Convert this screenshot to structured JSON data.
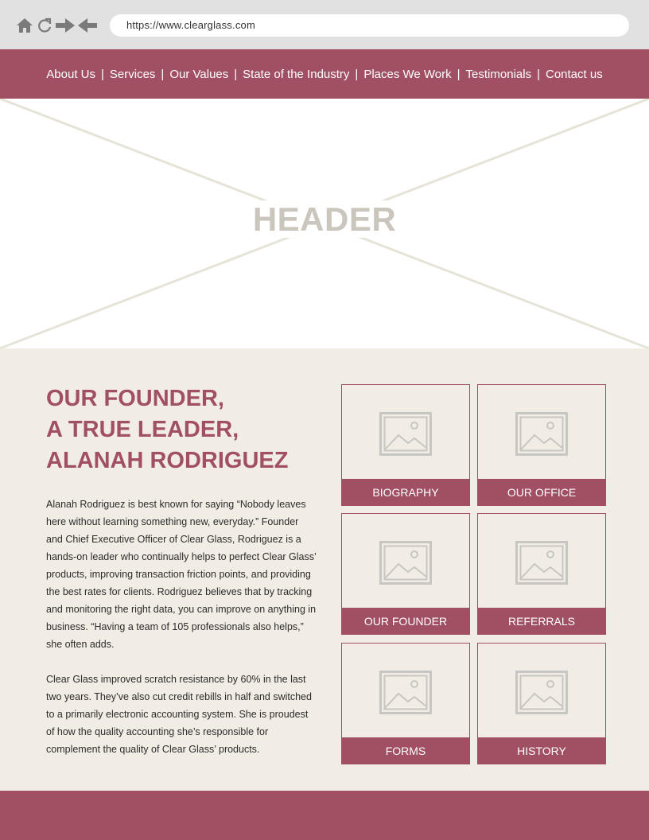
{
  "browser": {
    "url": "https://www.clearglass.com",
    "icons": [
      "home-icon",
      "refresh-icon",
      "forward-arrow-icon",
      "back-arrow-icon"
    ]
  },
  "nav": {
    "items": [
      {
        "label": "About Us"
      },
      {
        "label": "Services"
      },
      {
        "label": "Our Values"
      },
      {
        "label": "State of the Industry"
      },
      {
        "label": "Places We Work"
      },
      {
        "label": "Testimonials"
      },
      {
        "label": "Contact us"
      }
    ],
    "separator": "|"
  },
  "hero": {
    "label": "HEADER"
  },
  "content": {
    "headline": [
      "OUR FOUNDER,",
      "A TRUE LEADER,",
      "ALANAH RODRIGUEZ"
    ],
    "paragraph1": "Alanah Rodriguez is best known for saying “Nobody leaves here without learning something new, everyday.” Founder and Chief Executive Officer of Clear Glass, Rodriguez is a hands-on leader who continually helps to perfect Clear Glass’ products, improving transaction friction points, and providing the best rates for clients. Rodriguez believes that by tracking and monitoring the right data, you can improve on anything in business. “Having a team of 105 professionals also helps,” she often adds.",
    "paragraph2": "Clear Glass improved scratch resistance by  60% in the last two years. They’ve also cut credit rebills in half and switched to a primarily electronic accounting system. She is proudest of how the quality accounting she’s responsible for complement the quality of Clear Glass’ products."
  },
  "cards": [
    {
      "label": "BIOGRAPHY"
    },
    {
      "label": "OUR OFFICE"
    },
    {
      "label": "OUR FOUNDER"
    },
    {
      "label": "REFERRALS"
    },
    {
      "label": "FORMS"
    },
    {
      "label": "HISTORY"
    }
  ],
  "colors": {
    "brand": "#a15063",
    "background": "#f1ede4",
    "placeholder_gray": "#c8c6c2"
  }
}
